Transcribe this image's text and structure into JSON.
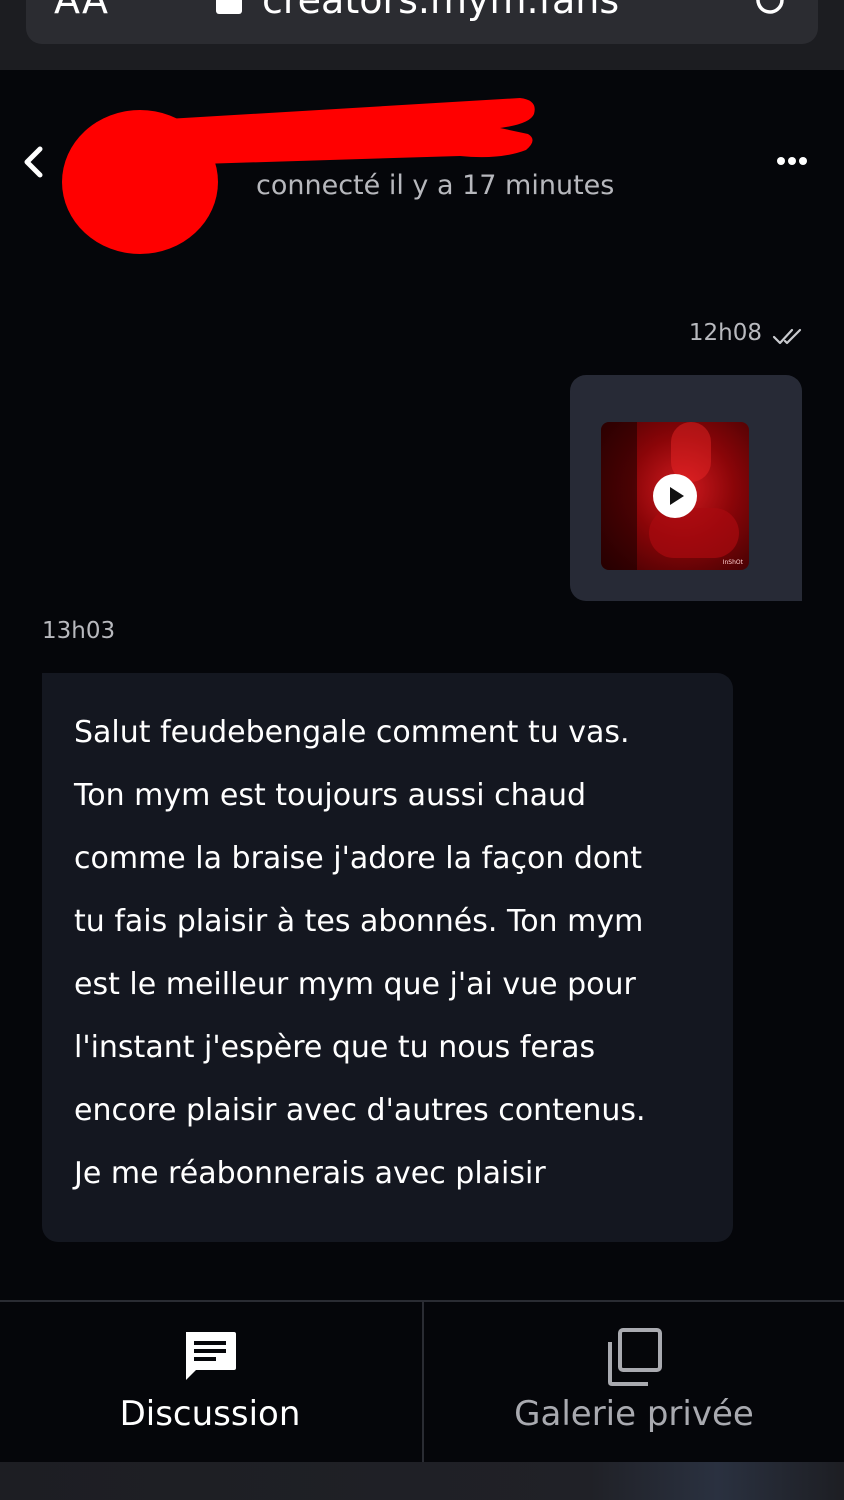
{
  "browser": {
    "text_size_label": "AA",
    "url": "creators.mym.fans",
    "lock_icon": "lock-icon",
    "reload_icon": "reload-icon"
  },
  "header": {
    "back_icon": "chevron-left-icon",
    "presence": "connecté il y a 17 minutes",
    "more_icon": "more-horizontal-icon",
    "redaction_color": "#ff0000"
  },
  "messages": [
    {
      "direction": "outgoing",
      "time": "12h08",
      "status_icon": "double-check-icon",
      "type": "video",
      "thumbnail_watermark": "InShOt",
      "play_icon": "play-icon"
    },
    {
      "direction": "incoming",
      "time": "13h03",
      "type": "text",
      "lines": [
        "Salut feudebengale comment tu vas.",
        "Ton mym est toujours aussi chaud",
        "comme la braise j'adore la façon dont",
        "tu fais plaisir à tes abonnés. Ton mym",
        "est le meilleur mym que j'ai vue pour",
        "l'instant j'espère que tu nous feras",
        "encore plaisir avec d'autres contenus.",
        "Je me réabonnerais avec plaisir"
      ]
    }
  ],
  "tabs": [
    {
      "label": "Discussion",
      "icon": "chat-icon",
      "active": true
    },
    {
      "label": "Galerie privée",
      "icon": "gallery-icon",
      "active": false
    }
  ],
  "colors": {
    "background": "#05060a",
    "outgoing_bubble": "#272a36",
    "incoming_bubble": "#141720",
    "muted_text": "#b8b9be"
  }
}
